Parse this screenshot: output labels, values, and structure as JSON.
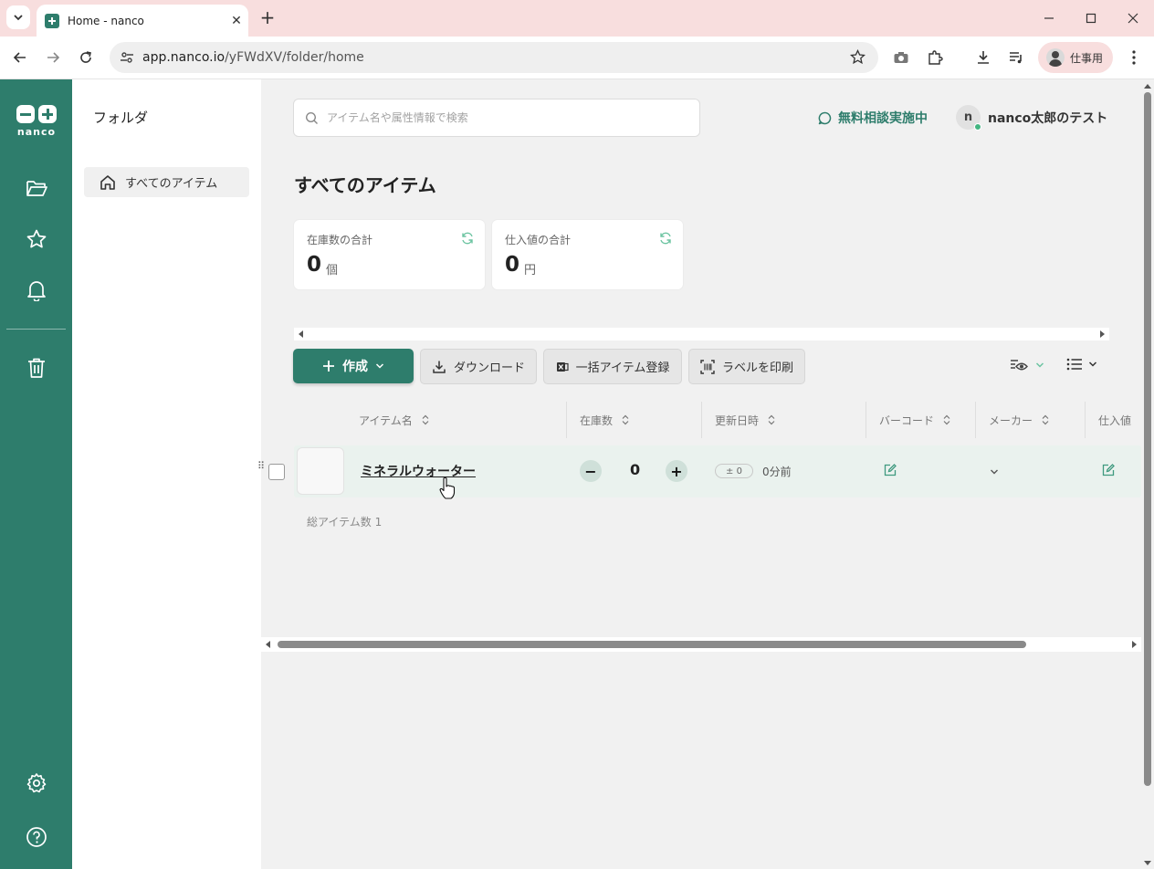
{
  "browser": {
    "tab_title": "Home - nanco",
    "url_host": "app.nanco.io",
    "url_path": "/yFWdXV/folder/home",
    "profile_label": "仕事用"
  },
  "rail": {
    "logo_text": "nanco",
    "icons": [
      "folder-icon",
      "star-icon",
      "bell-icon",
      "trash-icon",
      "gear-icon",
      "help-icon"
    ],
    "brand_color": "#2e7d6c"
  },
  "folders": {
    "title": "フォルダ",
    "items": [
      {
        "label": "すべてのアイテム"
      }
    ]
  },
  "header": {
    "search_placeholder": "アイテム名や属性情報で検索",
    "consult_label": "無料相談実施中",
    "user_initial": "n",
    "user_name": "nanco太郎のテスト"
  },
  "main": {
    "title": "すべてのアイテム",
    "stats": [
      {
        "label": "在庫数の合計",
        "value": "0",
        "unit": "個"
      },
      {
        "label": "仕入値の合計",
        "value": "0",
        "unit": "円"
      }
    ]
  },
  "actions": {
    "create": "作成",
    "download": "ダウンロード",
    "bulk_register": "一括アイテム登録",
    "print_label": "ラベルを印刷"
  },
  "table": {
    "columns": [
      "アイテム名",
      "在庫数",
      "更新日時",
      "バーコード",
      "メーカー",
      "仕入値"
    ],
    "rows": [
      {
        "name": "ミネラルウォーター",
        "qty": "0",
        "delta": "± 0",
        "updated": "0分前"
      }
    ],
    "total": "総アイテム数 1"
  }
}
